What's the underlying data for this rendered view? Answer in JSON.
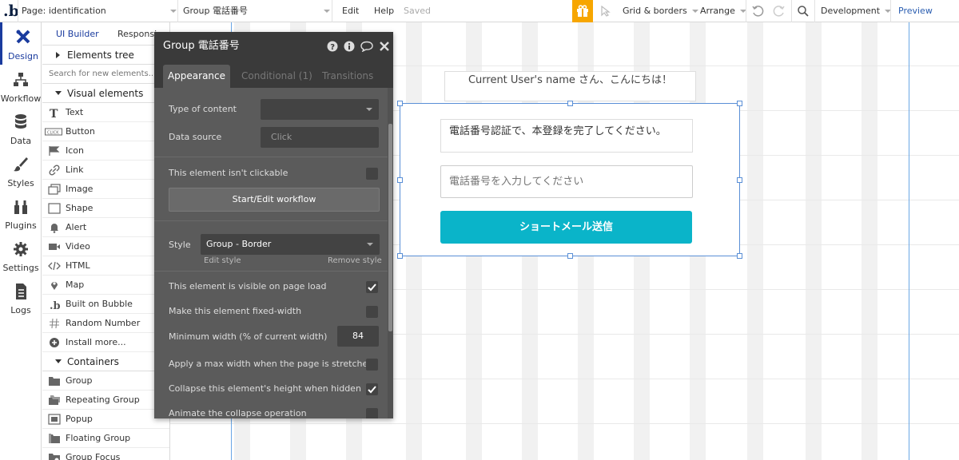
{
  "topbar": {
    "logo": ".b",
    "page_label": "Page: identification",
    "element_label": "Group 電話番号",
    "edit": "Edit",
    "help": "Help",
    "saved": "Saved",
    "grid_borders": "Grid & borders",
    "arrange": "Arrange",
    "development": "Development",
    "preview": "Preview"
  },
  "iconbar": {
    "items": [
      {
        "label": "Design",
        "icon": "design-icon"
      },
      {
        "label": "Workflow",
        "icon": "workflow-icon"
      },
      {
        "label": "Data",
        "icon": "data-icon"
      },
      {
        "label": "Styles",
        "icon": "styles-icon"
      },
      {
        "label": "Plugins",
        "icon": "plugins-icon"
      },
      {
        "label": "Settings",
        "icon": "settings-icon"
      },
      {
        "label": "Logs",
        "icon": "logs-icon"
      }
    ]
  },
  "panel": {
    "tab_ui": "UI Builder",
    "tab_resp": "Responsive",
    "elements_tree": "Elements tree",
    "search_placeholder": "Search for new elements...",
    "visual_section": "Visual elements",
    "visual_items": [
      "Text",
      "Button",
      "Icon",
      "Link",
      "Image",
      "Shape",
      "Alert",
      "Video",
      "HTML",
      "Map",
      "Built on Bubble",
      "Random Number",
      "Install more..."
    ],
    "containers_section": "Containers",
    "container_items": [
      "Group",
      "Repeating Group",
      "Popup",
      "Floating Group",
      "Group Focus"
    ]
  },
  "canvas": {
    "greeting": "Current User's name さん、こんにちは！",
    "instruction": "電話番号認証で、本登録を完了してください。",
    "phone_placeholder": "電話番号を入力してください",
    "sms_button": "ショートメール送信"
  },
  "editor": {
    "title": "Group 電話番号",
    "tab_appearance": "Appearance",
    "tab_conditional": "Conditional (1)",
    "tab_transitions": "Transitions",
    "type_of_content": "Type of content",
    "data_source": "Data source",
    "data_source_value": "Click",
    "not_clickable": "This element isn't clickable",
    "workflow_btn": "Start/Edit workflow",
    "style_label": "Style",
    "style_value": "Group - Border",
    "edit_style": "Edit style",
    "remove_style": "Remove style",
    "visible_on_load": "This element is visible on page load",
    "fixed_width": "Make this element fixed-width",
    "min_width": "Minimum width (% of current width)",
    "min_width_value": "84",
    "max_width": "Apply a max width when the page is stretched",
    "collapse_height": "Collapse this element's height when hidden",
    "animate_collapse": "Animate the collapse operation"
  }
}
